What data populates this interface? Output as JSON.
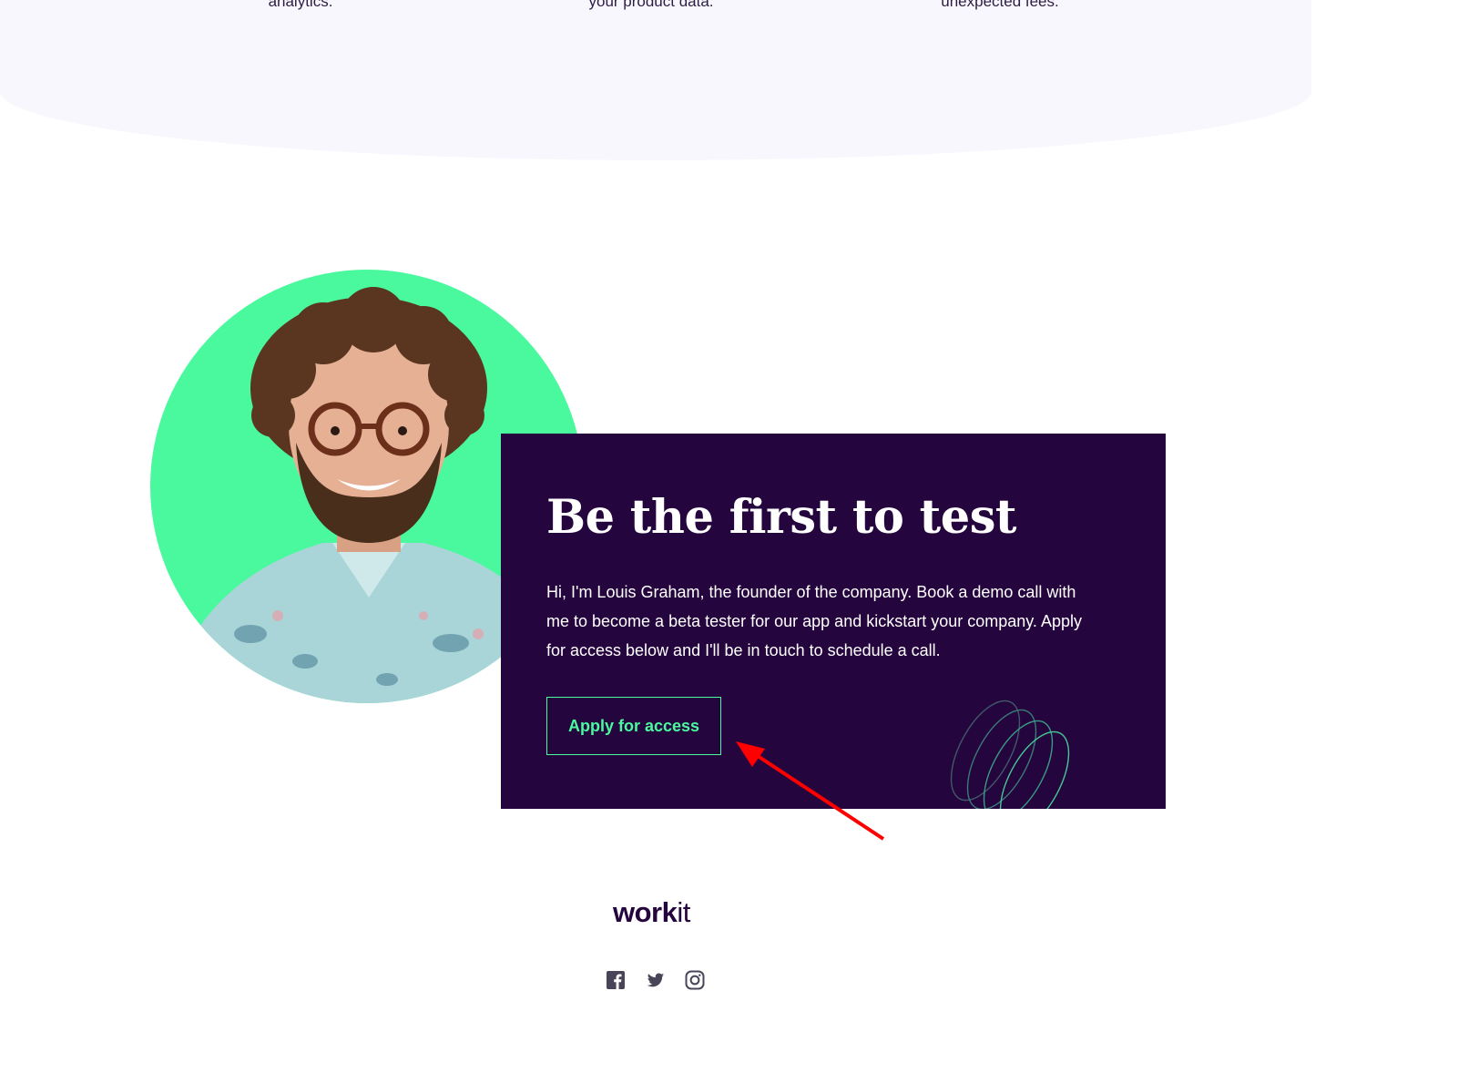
{
  "features": {
    "tail_1": "analytics.",
    "tail_2": "your product data.",
    "tail_3": "unexpected fees."
  },
  "cta": {
    "title": "Be the first to test",
    "body": "Hi, I'm Louis Graham, the founder of the company. Book a demo call with me to become a beta tester for our app and kickstart your company. Apply for access below and I'll be in touch to schedule a call.",
    "button_label": "Apply for access"
  },
  "footer": {
    "logo_bold": "work",
    "logo_light": "it",
    "social_icons": [
      "facebook-icon",
      "twitter-icon",
      "instagram-icon"
    ]
  },
  "colors": {
    "accent_green": "#4af99e",
    "dark_purple": "#25053d",
    "band_background": "#f9f7fe",
    "annotation_red": "#ff0000",
    "icon_gray": "#4a4458"
  }
}
